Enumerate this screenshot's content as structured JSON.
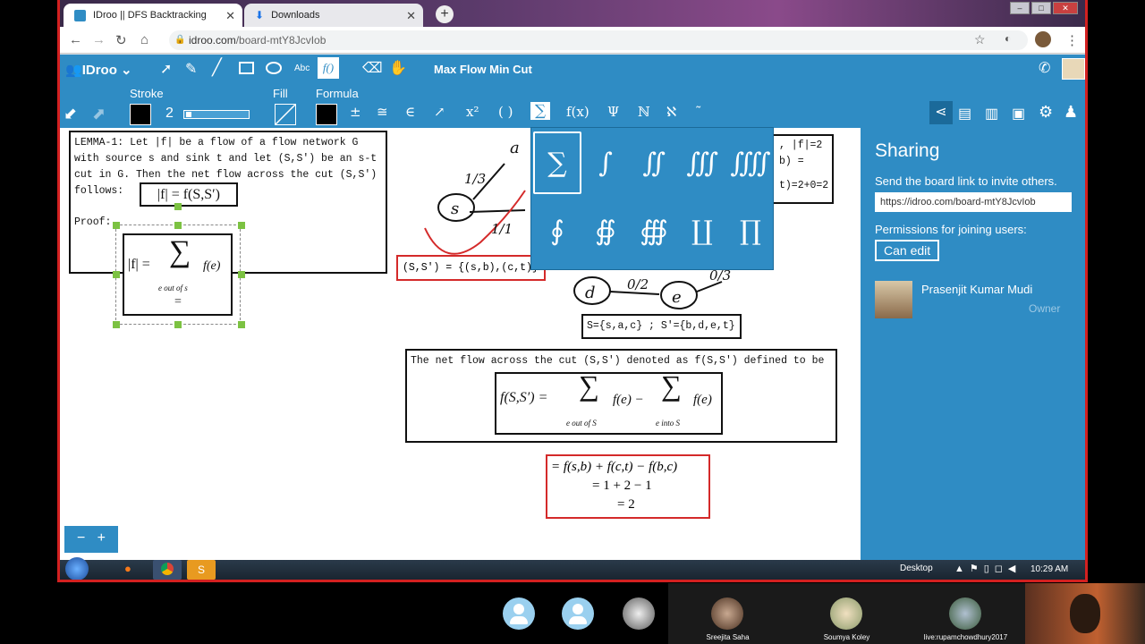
{
  "browser": {
    "tabs": [
      {
        "title": "IDroo || DFS Backtracking",
        "active": true
      },
      {
        "title": "Downloads",
        "active": false
      }
    ],
    "url_host": "idroo.com",
    "url_path": "/board-mtY8JcvIob"
  },
  "app": {
    "logo": "IDroo",
    "board_title": "Max Flow Min Cut",
    "labels": {
      "stroke": "Stroke",
      "fill": "Fill",
      "formula": "Formula"
    },
    "stroke_width": "2",
    "text_tool": "Abc",
    "formula_tool": "f()",
    "formula_symbols": [
      "±",
      "≅",
      "∈",
      "↗",
      "x²",
      "( )",
      "∑",
      "f(x)",
      "Ψ",
      "ℕ",
      "ℵ",
      "˜"
    ]
  },
  "palette": {
    "row1": [
      "∑",
      "∫",
      "∬",
      "∭",
      "⨌"
    ],
    "row2": [
      "∮",
      "∯",
      "∰",
      "∐",
      "∏"
    ]
  },
  "sharing": {
    "title": "Sharing",
    "subtitle": "Send the board link to invite others.",
    "link": "https://idroo.com/board-mtY8JcvIob",
    "permissions_label": "Permissions for joining users:",
    "permission_value": "Can edit",
    "user_name": "Prasenjit Kumar Mudi",
    "user_role": "Owner"
  },
  "board": {
    "lemma_lines": [
      "LEMMA-1: Let |f| be a flow of a flow network G",
      "with source s and sink t and let (S,S') be an s-t",
      "cut in G. Then the net flow across the cut (S,S')",
      "follows:"
    ],
    "lemma_formula": "|f|  =  f(S,S′)",
    "proof_label": "Proof:",
    "proof_lhs": "|f| =",
    "proof_sum": "∑",
    "proof_fe": "f(e)",
    "proof_sub": "e out of s",
    "proof_eq": "=",
    "cut_set": "(S,S') = {(s,b),(c,t)}",
    "partition": "S={s,a,c} ; S'={b,d,e,t}",
    "right_partial": [
      ", |f|=2",
      "b) =",
      "t)=2+0=2"
    ],
    "netflow_text": "The net flow across the cut (S,S') denoted as f(S,S') defined to be",
    "netflow_lhs": "f(S,S′) =",
    "netflow_sum1": "∑",
    "netflow_sub1": "e out of S",
    "netflow_fe1": "f(e) −",
    "netflow_sum2": "∑",
    "netflow_sub2": "e into S",
    "netflow_fe2": "f(e)",
    "calc_lines": [
      "= f(s,b) + f(c,t) − f(b,c)",
      "= 1 + 2 − 1",
      "= 2"
    ],
    "graph": {
      "nodes": [
        "s",
        "a",
        "d",
        "e"
      ],
      "edge_labels": [
        "1/3",
        "1/1",
        "0/2",
        "0/3"
      ]
    }
  },
  "taskbar": {
    "desktop_label": "Desktop",
    "time": "10:29 AM"
  },
  "meeting": {
    "participants": [
      "Sreejita Saha",
      "Soumya Koley",
      "live:rupamchowdhury2017"
    ]
  },
  "colors": {
    "accent": "#2f8cc4",
    "highlight": "#d42a2a",
    "frame": "#d32020"
  }
}
